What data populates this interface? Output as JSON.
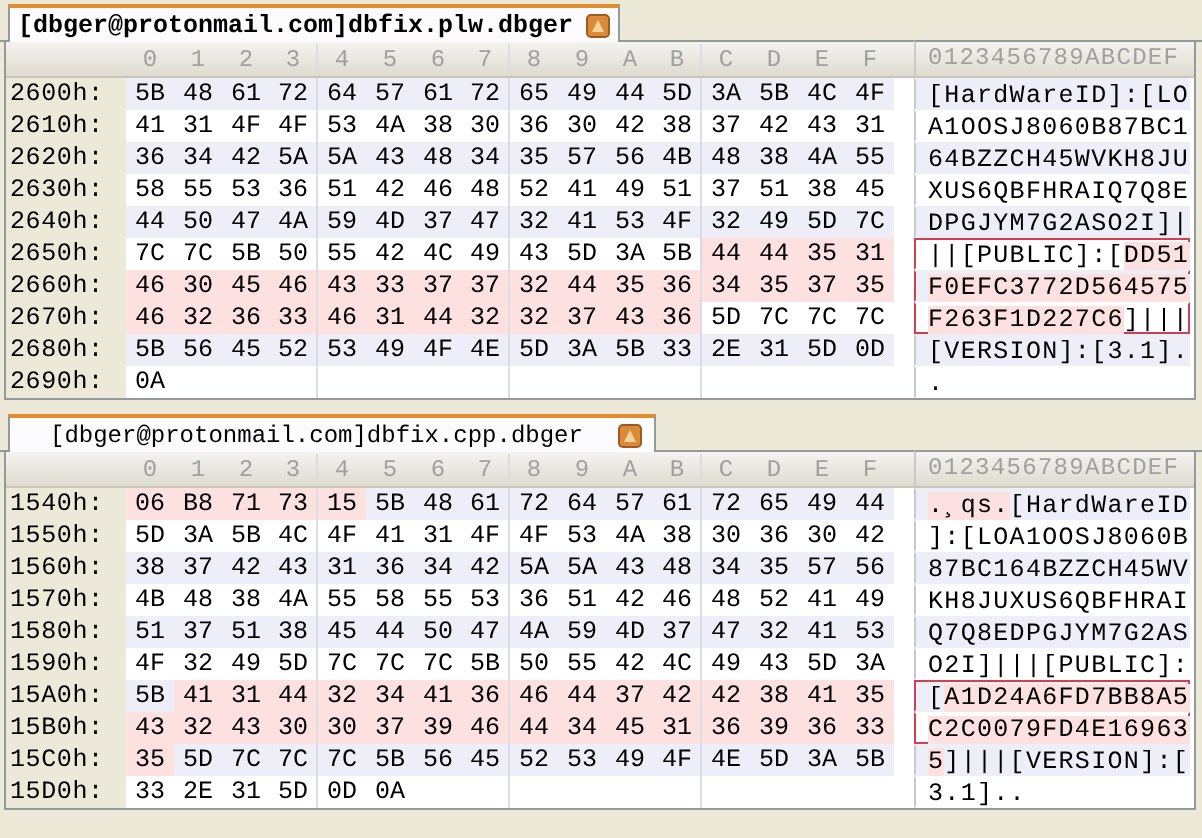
{
  "panels": [
    {
      "tab": {
        "title": "[dbger@protonmail.com]dbfix.plw.dbger"
      },
      "column_headers": [
        "0",
        "1",
        "2",
        "3",
        "4",
        "5",
        "6",
        "7",
        "8",
        "9",
        "A",
        "B",
        "C",
        "D",
        "E",
        "F"
      ],
      "ascii_header": "0123456789ABCDEF",
      "rows": [
        {
          "offset": "2600h:",
          "boxed": false,
          "ascii": "[HardWareID]:[LO",
          "bytes": [
            {
              "hex": "5B",
              "highlighted": false
            },
            {
              "hex": "48",
              "highlighted": false
            },
            {
              "hex": "61",
              "highlighted": false
            },
            {
              "hex": "72",
              "highlighted": false
            },
            {
              "hex": "64",
              "highlighted": false
            },
            {
              "hex": "57",
              "highlighted": false
            },
            {
              "hex": "61",
              "highlighted": false
            },
            {
              "hex": "72",
              "highlighted": false
            },
            {
              "hex": "65",
              "highlighted": false
            },
            {
              "hex": "49",
              "highlighted": false
            },
            {
              "hex": "44",
              "highlighted": false
            },
            {
              "hex": "5D",
              "highlighted": false
            },
            {
              "hex": "3A",
              "highlighted": false
            },
            {
              "hex": "5B",
              "highlighted": false
            },
            {
              "hex": "4C",
              "highlighted": false
            },
            {
              "hex": "4F",
              "highlighted": false
            }
          ]
        },
        {
          "offset": "2610h:",
          "boxed": false,
          "ascii": "A1OOSJ8060B87BC1",
          "bytes": [
            {
              "hex": "41",
              "highlighted": false
            },
            {
              "hex": "31",
              "highlighted": false
            },
            {
              "hex": "4F",
              "highlighted": false
            },
            {
              "hex": "4F",
              "highlighted": false
            },
            {
              "hex": "53",
              "highlighted": false
            },
            {
              "hex": "4A",
              "highlighted": false
            },
            {
              "hex": "38",
              "highlighted": false
            },
            {
              "hex": "30",
              "highlighted": false
            },
            {
              "hex": "36",
              "highlighted": false
            },
            {
              "hex": "30",
              "highlighted": false
            },
            {
              "hex": "42",
              "highlighted": false
            },
            {
              "hex": "38",
              "highlighted": false
            },
            {
              "hex": "37",
              "highlighted": false
            },
            {
              "hex": "42",
              "highlighted": false
            },
            {
              "hex": "43",
              "highlighted": false
            },
            {
              "hex": "31",
              "highlighted": false
            }
          ]
        },
        {
          "offset": "2620h:",
          "boxed": false,
          "ascii": "64BZZCH45WVKH8JU",
          "bytes": [
            {
              "hex": "36",
              "highlighted": false
            },
            {
              "hex": "34",
              "highlighted": false
            },
            {
              "hex": "42",
              "highlighted": false
            },
            {
              "hex": "5A",
              "highlighted": false
            },
            {
              "hex": "5A",
              "highlighted": false
            },
            {
              "hex": "43",
              "highlighted": false
            },
            {
              "hex": "48",
              "highlighted": false
            },
            {
              "hex": "34",
              "highlighted": false
            },
            {
              "hex": "35",
              "highlighted": false
            },
            {
              "hex": "57",
              "highlighted": false
            },
            {
              "hex": "56",
              "highlighted": false
            },
            {
              "hex": "4B",
              "highlighted": false
            },
            {
              "hex": "48",
              "highlighted": false
            },
            {
              "hex": "38",
              "highlighted": false
            },
            {
              "hex": "4A",
              "highlighted": false
            },
            {
              "hex": "55",
              "highlighted": false
            }
          ]
        },
        {
          "offset": "2630h:",
          "boxed": false,
          "ascii": "XUS6QBFHRAIQ7Q8E",
          "bytes": [
            {
              "hex": "58",
              "highlighted": false
            },
            {
              "hex": "55",
              "highlighted": false
            },
            {
              "hex": "53",
              "highlighted": false
            },
            {
              "hex": "36",
              "highlighted": false
            },
            {
              "hex": "51",
              "highlighted": false
            },
            {
              "hex": "42",
              "highlighted": false
            },
            {
              "hex": "46",
              "highlighted": false
            },
            {
              "hex": "48",
              "highlighted": false
            },
            {
              "hex": "52",
              "highlighted": false
            },
            {
              "hex": "41",
              "highlighted": false
            },
            {
              "hex": "49",
              "highlighted": false
            },
            {
              "hex": "51",
              "highlighted": false
            },
            {
              "hex": "37",
              "highlighted": false
            },
            {
              "hex": "51",
              "highlighted": false
            },
            {
              "hex": "38",
              "highlighted": false
            },
            {
              "hex": "45",
              "highlighted": false
            }
          ]
        },
        {
          "offset": "2640h:",
          "boxed": false,
          "ascii": "DPGJYM7G2ASO2I]|",
          "bytes": [
            {
              "hex": "44",
              "highlighted": false
            },
            {
              "hex": "50",
              "highlighted": false
            },
            {
              "hex": "47",
              "highlighted": false
            },
            {
              "hex": "4A",
              "highlighted": false
            },
            {
              "hex": "59",
              "highlighted": false
            },
            {
              "hex": "4D",
              "highlighted": false
            },
            {
              "hex": "37",
              "highlighted": false
            },
            {
              "hex": "47",
              "highlighted": false
            },
            {
              "hex": "32",
              "highlighted": false
            },
            {
              "hex": "41",
              "highlighted": false
            },
            {
              "hex": "53",
              "highlighted": false
            },
            {
              "hex": "4F",
              "highlighted": false
            },
            {
              "hex": "32",
              "highlighted": false
            },
            {
              "hex": "49",
              "highlighted": false
            },
            {
              "hex": "5D",
              "highlighted": false
            },
            {
              "hex": "7C",
              "highlighted": false
            }
          ]
        },
        {
          "offset": "2650h:",
          "boxed": true,
          "ascii": "||[PUBLIC]:[DD51",
          "bytes": [
            {
              "hex": "7C",
              "highlighted": false
            },
            {
              "hex": "7C",
              "highlighted": false
            },
            {
              "hex": "5B",
              "highlighted": false
            },
            {
              "hex": "50",
              "highlighted": false
            },
            {
              "hex": "55",
              "highlighted": false
            },
            {
              "hex": "42",
              "highlighted": false
            },
            {
              "hex": "4C",
              "highlighted": false
            },
            {
              "hex": "49",
              "highlighted": false
            },
            {
              "hex": "43",
              "highlighted": false
            },
            {
              "hex": "5D",
              "highlighted": false
            },
            {
              "hex": "3A",
              "highlighted": false
            },
            {
              "hex": "5B",
              "highlighted": false
            },
            {
              "hex": "44",
              "highlighted": true
            },
            {
              "hex": "44",
              "highlighted": true
            },
            {
              "hex": "35",
              "highlighted": true
            },
            {
              "hex": "31",
              "highlighted": true
            }
          ]
        },
        {
          "offset": "2660h:",
          "boxed": true,
          "ascii": "F0EFC3772D564575",
          "bytes": [
            {
              "hex": "46",
              "highlighted": true
            },
            {
              "hex": "30",
              "highlighted": true
            },
            {
              "hex": "45",
              "highlighted": true
            },
            {
              "hex": "46",
              "highlighted": true
            },
            {
              "hex": "43",
              "highlighted": true
            },
            {
              "hex": "33",
              "highlighted": true
            },
            {
              "hex": "37",
              "highlighted": true
            },
            {
              "hex": "37",
              "highlighted": true
            },
            {
              "hex": "32",
              "highlighted": true
            },
            {
              "hex": "44",
              "highlighted": true
            },
            {
              "hex": "35",
              "highlighted": true
            },
            {
              "hex": "36",
              "highlighted": true
            },
            {
              "hex": "34",
              "highlighted": true
            },
            {
              "hex": "35",
              "highlighted": true
            },
            {
              "hex": "37",
              "highlighted": true
            },
            {
              "hex": "35",
              "highlighted": true
            }
          ]
        },
        {
          "offset": "2670h:",
          "boxed": true,
          "ascii": "F263F1D227C6]|||",
          "bytes": [
            {
              "hex": "46",
              "highlighted": true
            },
            {
              "hex": "32",
              "highlighted": true
            },
            {
              "hex": "36",
              "highlighted": true
            },
            {
              "hex": "33",
              "highlighted": true
            },
            {
              "hex": "46",
              "highlighted": true
            },
            {
              "hex": "31",
              "highlighted": true
            },
            {
              "hex": "44",
              "highlighted": true
            },
            {
              "hex": "32",
              "highlighted": true
            },
            {
              "hex": "32",
              "highlighted": true
            },
            {
              "hex": "37",
              "highlighted": true
            },
            {
              "hex": "43",
              "highlighted": true
            },
            {
              "hex": "36",
              "highlighted": true
            },
            {
              "hex": "5D",
              "highlighted": false
            },
            {
              "hex": "7C",
              "highlighted": false
            },
            {
              "hex": "7C",
              "highlighted": false
            },
            {
              "hex": "7C",
              "highlighted": false
            }
          ]
        },
        {
          "offset": "2680h:",
          "boxed": false,
          "ascii": "[VERSION]:[3.1].",
          "bytes": [
            {
              "hex": "5B",
              "highlighted": false
            },
            {
              "hex": "56",
              "highlighted": false
            },
            {
              "hex": "45",
              "highlighted": false
            },
            {
              "hex": "52",
              "highlighted": false
            },
            {
              "hex": "53",
              "highlighted": false
            },
            {
              "hex": "49",
              "highlighted": false
            },
            {
              "hex": "4F",
              "highlighted": false
            },
            {
              "hex": "4E",
              "highlighted": false
            },
            {
              "hex": "5D",
              "highlighted": false
            },
            {
              "hex": "3A",
              "highlighted": false
            },
            {
              "hex": "5B",
              "highlighted": false
            },
            {
              "hex": "33",
              "highlighted": false
            },
            {
              "hex": "2E",
              "highlighted": false
            },
            {
              "hex": "31",
              "highlighted": false
            },
            {
              "hex": "5D",
              "highlighted": false
            },
            {
              "hex": "0D",
              "highlighted": false
            }
          ]
        },
        {
          "offset": "2690h:",
          "boxed": false,
          "ascii": ".",
          "bytes": [
            {
              "hex": "0A",
              "highlighted": false
            }
          ]
        }
      ]
    },
    {
      "tab": {
        "title": "[dbger@protonmail.com]dbfix.cpp.dbger"
      },
      "column_headers": [
        "0",
        "1",
        "2",
        "3",
        "4",
        "5",
        "6",
        "7",
        "8",
        "9",
        "A",
        "B",
        "C",
        "D",
        "E",
        "F"
      ],
      "ascii_header": "0123456789ABCDEF",
      "rows": [
        {
          "offset": "1540h:",
          "boxed": false,
          "ascii": ".¸qs.[HardWareID",
          "bytes": [
            {
              "hex": "06",
              "highlighted": true
            },
            {
              "hex": "B8",
              "highlighted": true
            },
            {
              "hex": "71",
              "highlighted": true
            },
            {
              "hex": "73",
              "highlighted": true
            },
            {
              "hex": "15",
              "highlighted": true
            },
            {
              "hex": "5B",
              "highlighted": false
            },
            {
              "hex": "48",
              "highlighted": false
            },
            {
              "hex": "61",
              "highlighted": false
            },
            {
              "hex": "72",
              "highlighted": false
            },
            {
              "hex": "64",
              "highlighted": false
            },
            {
              "hex": "57",
              "highlighted": false
            },
            {
              "hex": "61",
              "highlighted": false
            },
            {
              "hex": "72",
              "highlighted": false
            },
            {
              "hex": "65",
              "highlighted": false
            },
            {
              "hex": "49",
              "highlighted": false
            },
            {
              "hex": "44",
              "highlighted": false
            }
          ]
        },
        {
          "offset": "1550h:",
          "boxed": false,
          "ascii": "]:[LOA1OOSJ8060B",
          "bytes": [
            {
              "hex": "5D",
              "highlighted": false
            },
            {
              "hex": "3A",
              "highlighted": false
            },
            {
              "hex": "5B",
              "highlighted": false
            },
            {
              "hex": "4C",
              "highlighted": false
            },
            {
              "hex": "4F",
              "highlighted": false
            },
            {
              "hex": "41",
              "highlighted": false
            },
            {
              "hex": "31",
              "highlighted": false
            },
            {
              "hex": "4F",
              "highlighted": false
            },
            {
              "hex": "4F",
              "highlighted": false
            },
            {
              "hex": "53",
              "highlighted": false
            },
            {
              "hex": "4A",
              "highlighted": false
            },
            {
              "hex": "38",
              "highlighted": false
            },
            {
              "hex": "30",
              "highlighted": false
            },
            {
              "hex": "36",
              "highlighted": false
            },
            {
              "hex": "30",
              "highlighted": false
            },
            {
              "hex": "42",
              "highlighted": false
            }
          ]
        },
        {
          "offset": "1560h:",
          "boxed": false,
          "ascii": "87BC164BZZCH45WV",
          "bytes": [
            {
              "hex": "38",
              "highlighted": false
            },
            {
              "hex": "37",
              "highlighted": false
            },
            {
              "hex": "42",
              "highlighted": false
            },
            {
              "hex": "43",
              "highlighted": false
            },
            {
              "hex": "31",
              "highlighted": false
            },
            {
              "hex": "36",
              "highlighted": false
            },
            {
              "hex": "34",
              "highlighted": false
            },
            {
              "hex": "42",
              "highlighted": false
            },
            {
              "hex": "5A",
              "highlighted": false
            },
            {
              "hex": "5A",
              "highlighted": false
            },
            {
              "hex": "43",
              "highlighted": false
            },
            {
              "hex": "48",
              "highlighted": false
            },
            {
              "hex": "34",
              "highlighted": false
            },
            {
              "hex": "35",
              "highlighted": false
            },
            {
              "hex": "57",
              "highlighted": false
            },
            {
              "hex": "56",
              "highlighted": false
            }
          ]
        },
        {
          "offset": "1570h:",
          "boxed": false,
          "ascii": "KH8JUXUS6QBFHRAI",
          "bytes": [
            {
              "hex": "4B",
              "highlighted": false
            },
            {
              "hex": "48",
              "highlighted": false
            },
            {
              "hex": "38",
              "highlighted": false
            },
            {
              "hex": "4A",
              "highlighted": false
            },
            {
              "hex": "55",
              "highlighted": false
            },
            {
              "hex": "58",
              "highlighted": false
            },
            {
              "hex": "55",
              "highlighted": false
            },
            {
              "hex": "53",
              "highlighted": false
            },
            {
              "hex": "36",
              "highlighted": false
            },
            {
              "hex": "51",
              "highlighted": false
            },
            {
              "hex": "42",
              "highlighted": false
            },
            {
              "hex": "46",
              "highlighted": false
            },
            {
              "hex": "48",
              "highlighted": false
            },
            {
              "hex": "52",
              "highlighted": false
            },
            {
              "hex": "41",
              "highlighted": false
            },
            {
              "hex": "49",
              "highlighted": false
            }
          ]
        },
        {
          "offset": "1580h:",
          "boxed": false,
          "ascii": "Q7Q8EDPGJYM7G2AS",
          "bytes": [
            {
              "hex": "51",
              "highlighted": false
            },
            {
              "hex": "37",
              "highlighted": false
            },
            {
              "hex": "51",
              "highlighted": false
            },
            {
              "hex": "38",
              "highlighted": false
            },
            {
              "hex": "45",
              "highlighted": false
            },
            {
              "hex": "44",
              "highlighted": false
            },
            {
              "hex": "50",
              "highlighted": false
            },
            {
              "hex": "47",
              "highlighted": false
            },
            {
              "hex": "4A",
              "highlighted": false
            },
            {
              "hex": "59",
              "highlighted": false
            },
            {
              "hex": "4D",
              "highlighted": false
            },
            {
              "hex": "37",
              "highlighted": false
            },
            {
              "hex": "47",
              "highlighted": false
            },
            {
              "hex": "32",
              "highlighted": false
            },
            {
              "hex": "41",
              "highlighted": false
            },
            {
              "hex": "53",
              "highlighted": false
            }
          ]
        },
        {
          "offset": "1590h:",
          "boxed": false,
          "ascii": "O2I]|||[PUBLIC]:",
          "bytes": [
            {
              "hex": "4F",
              "highlighted": false
            },
            {
              "hex": "32",
              "highlighted": false
            },
            {
              "hex": "49",
              "highlighted": false
            },
            {
              "hex": "5D",
              "highlighted": false
            },
            {
              "hex": "7C",
              "highlighted": false
            },
            {
              "hex": "7C",
              "highlighted": false
            },
            {
              "hex": "7C",
              "highlighted": false
            },
            {
              "hex": "5B",
              "highlighted": false
            },
            {
              "hex": "50",
              "highlighted": false
            },
            {
              "hex": "55",
              "highlighted": false
            },
            {
              "hex": "42",
              "highlighted": false
            },
            {
              "hex": "4C",
              "highlighted": false
            },
            {
              "hex": "49",
              "highlighted": false
            },
            {
              "hex": "43",
              "highlighted": false
            },
            {
              "hex": "5D",
              "highlighted": false
            },
            {
              "hex": "3A",
              "highlighted": false
            }
          ]
        },
        {
          "offset": "15A0h:",
          "boxed": true,
          "ascii": "[A1D24A6FD7BB8A5",
          "bytes": [
            {
              "hex": "5B",
              "highlighted": false
            },
            {
              "hex": "41",
              "highlighted": true
            },
            {
              "hex": "31",
              "highlighted": true
            },
            {
              "hex": "44",
              "highlighted": true
            },
            {
              "hex": "32",
              "highlighted": true
            },
            {
              "hex": "34",
              "highlighted": true
            },
            {
              "hex": "41",
              "highlighted": true
            },
            {
              "hex": "36",
              "highlighted": true
            },
            {
              "hex": "46",
              "highlighted": true
            },
            {
              "hex": "44",
              "highlighted": true
            },
            {
              "hex": "37",
              "highlighted": true
            },
            {
              "hex": "42",
              "highlighted": true
            },
            {
              "hex": "42",
              "highlighted": true
            },
            {
              "hex": "38",
              "highlighted": true
            },
            {
              "hex": "41",
              "highlighted": true
            },
            {
              "hex": "35",
              "highlighted": true
            }
          ]
        },
        {
          "offset": "15B0h:",
          "boxed": true,
          "ascii": "C2C0079FD4E16963",
          "bytes": [
            {
              "hex": "43",
              "highlighted": true
            },
            {
              "hex": "32",
              "highlighted": true
            },
            {
              "hex": "43",
              "highlighted": true
            },
            {
              "hex": "30",
              "highlighted": true
            },
            {
              "hex": "30",
              "highlighted": true
            },
            {
              "hex": "37",
              "highlighted": true
            },
            {
              "hex": "39",
              "highlighted": true
            },
            {
              "hex": "46",
              "highlighted": true
            },
            {
              "hex": "44",
              "highlighted": true
            },
            {
              "hex": "34",
              "highlighted": true
            },
            {
              "hex": "45",
              "highlighted": true
            },
            {
              "hex": "31",
              "highlighted": true
            },
            {
              "hex": "36",
              "highlighted": true
            },
            {
              "hex": "39",
              "highlighted": true
            },
            {
              "hex": "36",
              "highlighted": true
            },
            {
              "hex": "33",
              "highlighted": true
            }
          ]
        },
        {
          "offset": "15C0h:",
          "boxed": false,
          "ascii": "5]|||[VERSION]:[",
          "bytes": [
            {
              "hex": "35",
              "highlighted": true
            },
            {
              "hex": "5D",
              "highlighted": false
            },
            {
              "hex": "7C",
              "highlighted": false
            },
            {
              "hex": "7C",
              "highlighted": false
            },
            {
              "hex": "7C",
              "highlighted": false
            },
            {
              "hex": "5B",
              "highlighted": false
            },
            {
              "hex": "56",
              "highlighted": false
            },
            {
              "hex": "45",
              "highlighted": false
            },
            {
              "hex": "52",
              "highlighted": false
            },
            {
              "hex": "53",
              "highlighted": false
            },
            {
              "hex": "49",
              "highlighted": false
            },
            {
              "hex": "4F",
              "highlighted": false
            },
            {
              "hex": "4E",
              "highlighted": false
            },
            {
              "hex": "5D",
              "highlighted": false
            },
            {
              "hex": "3A",
              "highlighted": false
            },
            {
              "hex": "5B",
              "highlighted": false
            }
          ]
        },
        {
          "offset": "15D0h:",
          "boxed": false,
          "ascii": "3.1]..",
          "bytes": [
            {
              "hex": "33",
              "highlighted": false
            },
            {
              "hex": "2E",
              "highlighted": false
            },
            {
              "hex": "31",
              "highlighted": false
            },
            {
              "hex": "5D",
              "highlighted": false
            },
            {
              "hex": "0D",
              "highlighted": false
            },
            {
              "hex": "0A",
              "highlighted": false
            }
          ]
        }
      ]
    }
  ]
}
